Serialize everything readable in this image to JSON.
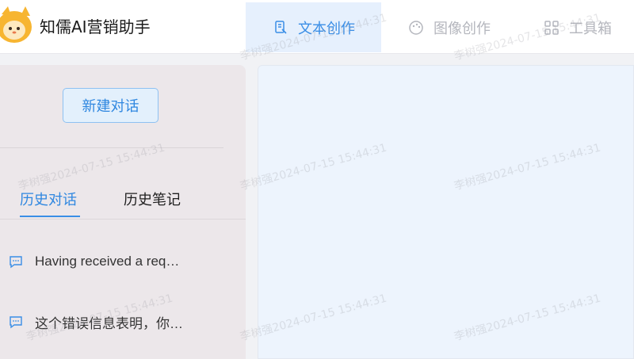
{
  "header": {
    "app_title": "知儒AI营销助手",
    "nav_tabs": [
      {
        "label": "文本创作",
        "icon": "document-icon",
        "active": true
      },
      {
        "label": "图像创作",
        "icon": "palette-icon",
        "active": false
      },
      {
        "label": "工具箱",
        "icon": "grid-icon",
        "active": false
      }
    ]
  },
  "sidebar": {
    "new_chat_label": "新建对话",
    "tabs": [
      {
        "label": "历史对话",
        "active": true
      },
      {
        "label": "历史笔记",
        "active": false
      }
    ],
    "conversations": [
      {
        "title": "Having received a req…",
        "icon": "chat-icon"
      },
      {
        "title": "这个错误信息表明，你…",
        "icon": "chat-icon"
      }
    ]
  },
  "watermark": "李树强2024-07-15 15:44:31",
  "colors": {
    "accent": "#3a8ee6",
    "active_tab_bg": "#e6f0fd",
    "sidebar_bg": "#ece7ea",
    "main_bg": "#edf4fd"
  }
}
